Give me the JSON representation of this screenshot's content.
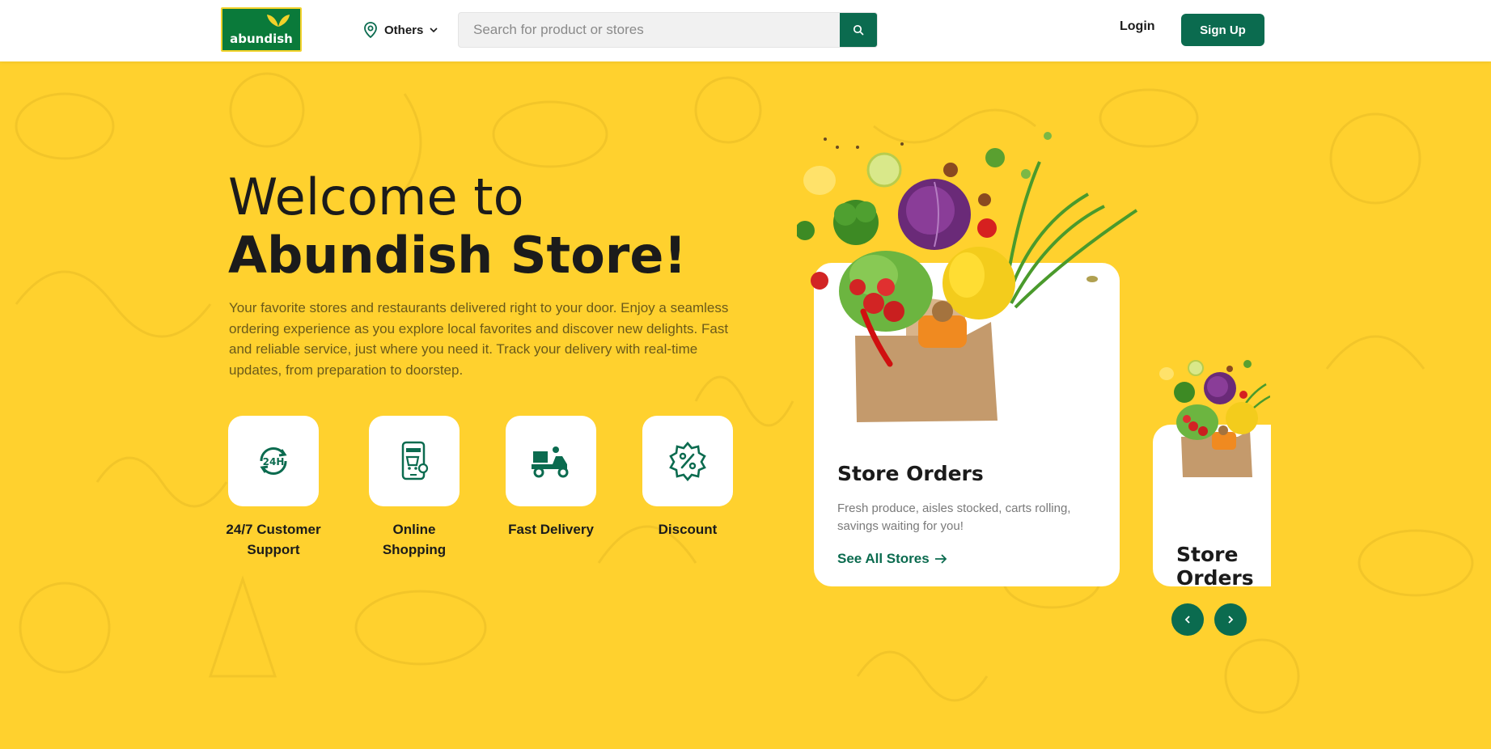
{
  "header": {
    "logo_text": "abundish",
    "location_label": "Others",
    "search_placeholder": "Search for product or stores",
    "login_label": "Login",
    "signup_label": "Sign Up"
  },
  "hero": {
    "title_line1": "Welcome to",
    "title_line2": "Abundish Store!",
    "description": "Your favorite stores and restaurants delivered right to your door. Enjoy a seamless ordering experience as you explore local favorites and discover new delights. Fast and reliable service, just where you need it. Track your delivery with real-time updates, from preparation to doorstep."
  },
  "features": [
    {
      "label": "24/7 Customer Support",
      "icon": "support-24h-icon"
    },
    {
      "label": "Online Shopping",
      "icon": "online-shopping-icon"
    },
    {
      "label": "Fast Delivery",
      "icon": "delivery-scooter-icon"
    },
    {
      "label": "Discount",
      "icon": "discount-badge-icon"
    }
  ],
  "cards": [
    {
      "title": "Store Orders",
      "description": "Fresh produce, aisles stocked, carts rolling, savings waiting for you!",
      "link_label": "See All Stores"
    },
    {
      "title": "Store Orders"
    }
  ],
  "colors": {
    "brand_green": "#0b6b4f",
    "logo_green": "#0a7a3a",
    "background_yellow": "#ffd12e",
    "white": "#ffffff"
  }
}
